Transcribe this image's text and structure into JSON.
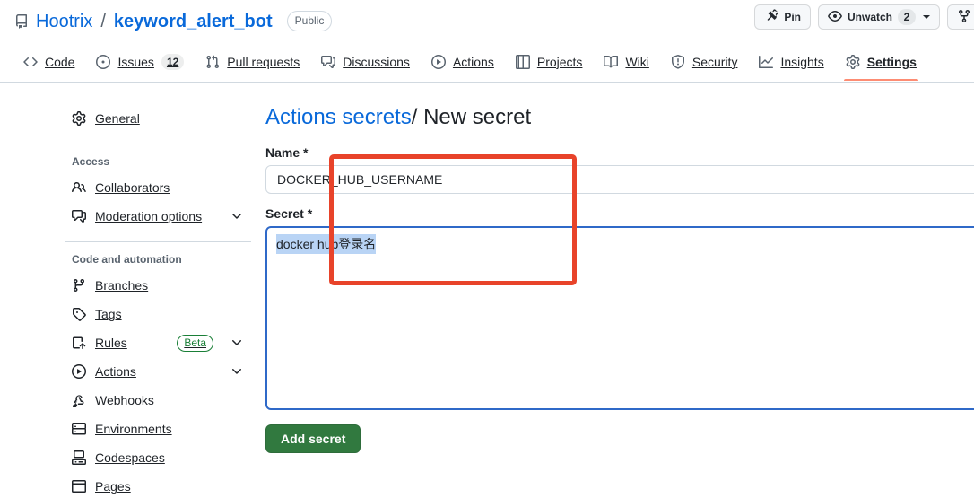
{
  "header": {
    "repo_icon": "repo-icon",
    "owner": "Hootrix",
    "separator": "/",
    "name": "keyword_alert_bot",
    "visibility": "Public",
    "actions": [
      {
        "icon": "pin-icon",
        "label": "Pin",
        "count": null,
        "caret": false
      },
      {
        "icon": "eye-icon",
        "label": "Unwatch",
        "count": "2",
        "caret": true
      },
      {
        "icon": "fork-icon",
        "label": "",
        "count": null,
        "caret": false
      }
    ]
  },
  "nav": {
    "tabs": [
      {
        "icon": "code-icon",
        "label": "Code",
        "count": null,
        "selected": false
      },
      {
        "icon": "issue-opened-icon",
        "label": "Issues",
        "count": "12",
        "selected": false
      },
      {
        "icon": "git-pull-request-icon",
        "label": "Pull requests",
        "count": null,
        "selected": false
      },
      {
        "icon": "comment-discussion-icon",
        "label": "Discussions",
        "count": null,
        "selected": false
      },
      {
        "icon": "play-icon",
        "label": "Actions",
        "count": null,
        "selected": false
      },
      {
        "icon": "table-icon",
        "label": "Projects",
        "count": null,
        "selected": false
      },
      {
        "icon": "book-icon",
        "label": "Wiki",
        "count": null,
        "selected": false
      },
      {
        "icon": "shield-icon",
        "label": "Security",
        "count": null,
        "selected": false
      },
      {
        "icon": "graph-icon",
        "label": "Insights",
        "count": null,
        "selected": false
      },
      {
        "icon": "gear-icon",
        "label": "Settings",
        "count": null,
        "selected": true
      }
    ]
  },
  "sidebar": {
    "general": {
      "icon": "gear-icon",
      "label": "General"
    },
    "groups": [
      {
        "title": "Access",
        "items": [
          {
            "icon": "people-icon",
            "label": "Collaborators",
            "chevron": false,
            "badge": null
          },
          {
            "icon": "comment-discussion-icon",
            "label": "Moderation options",
            "chevron": true,
            "badge": null
          }
        ]
      },
      {
        "title": "Code and automation",
        "items": [
          {
            "icon": "git-branch-icon",
            "label": "Branches",
            "chevron": false,
            "badge": null
          },
          {
            "icon": "tag-icon",
            "label": "Tags",
            "chevron": false,
            "badge": null
          },
          {
            "icon": "rules-icon",
            "label": "Rules",
            "chevron": true,
            "badge": "Beta"
          },
          {
            "icon": "play-icon",
            "label": "Actions",
            "chevron": true,
            "badge": null
          },
          {
            "icon": "webhook-icon",
            "label": "Webhooks",
            "chevron": false,
            "badge": null
          },
          {
            "icon": "server-icon",
            "label": "Environments",
            "chevron": false,
            "badge": null
          },
          {
            "icon": "codespaces-icon",
            "label": "Codespaces",
            "chevron": false,
            "badge": null
          },
          {
            "icon": "browser-icon",
            "label": "Pages",
            "chevron": false,
            "badge": null
          }
        ]
      }
    ]
  },
  "main": {
    "title_link": "Actions secrets",
    "title_separator": "/",
    "title_current": "New secret",
    "name_label": "Name *",
    "name_value": "DOCKER_HUB_USERNAME",
    "name_placeholder": "",
    "secret_label": "Secret *",
    "secret_value": "docker hub登录名",
    "secret_placeholder": "",
    "submit_label": "Add secret"
  },
  "annotation": {
    "color": "#e8432a",
    "shape": "rectangle"
  }
}
